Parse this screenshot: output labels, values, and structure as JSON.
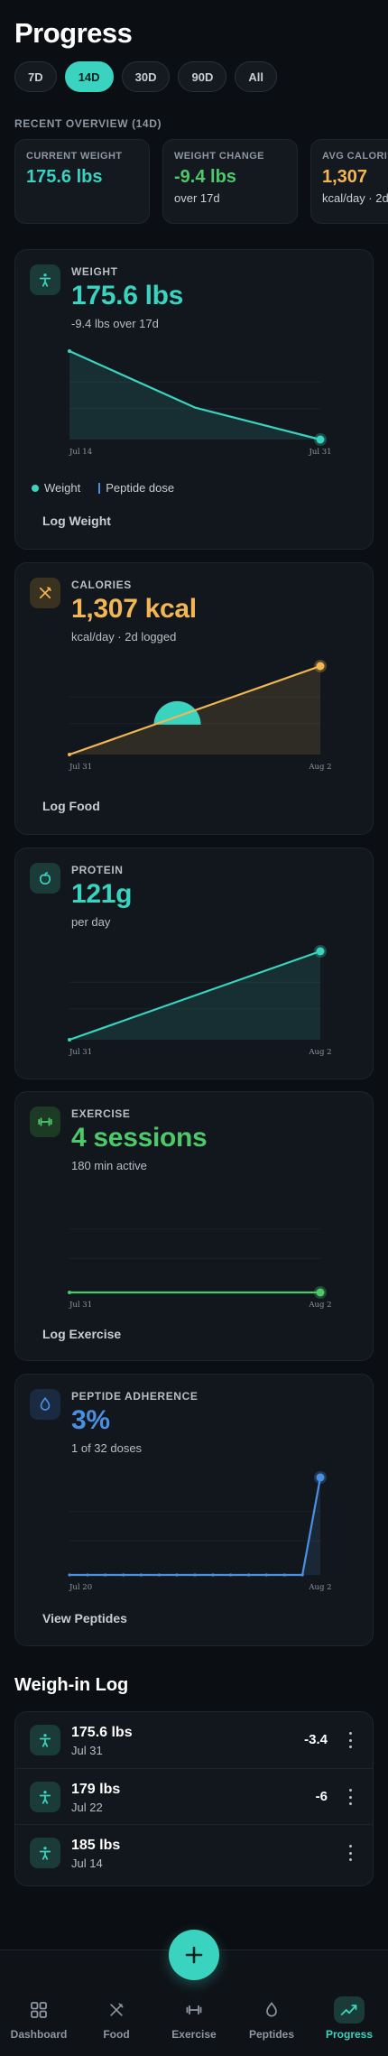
{
  "page": {
    "title": "Progress"
  },
  "ranges": [
    {
      "label": "7D",
      "active": false
    },
    {
      "label": "14D",
      "active": true
    },
    {
      "label": "30D",
      "active": false
    },
    {
      "label": "90D",
      "active": false
    },
    {
      "label": "All",
      "active": false
    }
  ],
  "overview": {
    "label": "RECENT OVERVIEW (14D)",
    "cards": [
      {
        "label": "CURRENT WEIGHT",
        "value": "175.6 lbs",
        "sub": "",
        "color": "#3ad3c0"
      },
      {
        "label": "WEIGHT CHANGE",
        "value": "-9.4 lbs",
        "sub": "over 17d",
        "color": "#4cc96a"
      },
      {
        "label": "AVG CALORIES",
        "value": "1,307",
        "sub": "kcal/day · 2d",
        "color": "#f3b654"
      }
    ]
  },
  "weight": {
    "label": "WEIGHT",
    "value": "175.6 lbs",
    "sub": "-9.4 lbs over 17d",
    "color": "#3ad3c0",
    "legend_weight": "Weight",
    "legend_peptide": "Peptide dose",
    "link": "Log Weight"
  },
  "calories": {
    "label": "CALORIES",
    "value": "1,307 kcal",
    "sub": "kcal/day · 2d logged",
    "color": "#f3b654",
    "link": "Log Food"
  },
  "protein": {
    "label": "PROTEIN",
    "value": "121g",
    "sub": "per day",
    "color": "#3ad3c0"
  },
  "exercise": {
    "label": "EXERCISE",
    "value": "4 sessions",
    "sub": "180 min active",
    "color": "#4cc96a",
    "link": "Log Exercise"
  },
  "peptide": {
    "label": "PEPTIDE ADHERENCE",
    "value": "3%",
    "sub": "1 of 32 doses",
    "color": "#4a90e2",
    "link": "View Peptides"
  },
  "chart_data": [
    {
      "type": "area",
      "series": [
        {
          "values": [
            185,
            179,
            175.6
          ]
        }
      ],
      "x": [
        "Jul 14",
        "Jul 22",
        "Jul 31"
      ],
      "tick_labels": [
        "Jul 14",
        "Jul 31"
      ]
    },
    {
      "type": "area",
      "x": [
        "Jul 31",
        "Aug 2"
      ],
      "tick_labels": [
        "Jul 31",
        "Aug 2"
      ],
      "series": [
        {
          "values": [
            400,
            1650
          ]
        }
      ]
    },
    {
      "type": "area",
      "x": [
        "Jul 31",
        "Aug 2"
      ],
      "tick_labels": [
        "Jul 31",
        "Aug 2"
      ],
      "series": [
        {
          "values": [
            0,
            121
          ]
        }
      ]
    },
    {
      "type": "line",
      "x": [
        "Jul 31",
        "Aug 2"
      ],
      "tick_labels": [
        "Jul 31",
        "Aug 2"
      ],
      "series": [
        {
          "values": [
            0,
            0
          ]
        }
      ]
    },
    {
      "type": "area",
      "x": [
        "Jul 20",
        "Aug 2"
      ],
      "tick_labels": [
        "Jul 20",
        "Aug 2"
      ],
      "series": [
        {
          "values": [
            0,
            0,
            0,
            0,
            0,
            0,
            0,
            0,
            0,
            0,
            0,
            0,
            0,
            0,
            1
          ]
        }
      ]
    }
  ],
  "log": {
    "title": "Weigh-in Log",
    "entries": [
      {
        "weight": "175.6 lbs",
        "date": "Jul 31",
        "change": "-3.4"
      },
      {
        "weight": "179 lbs",
        "date": "Jul 22",
        "change": "-6"
      },
      {
        "weight": "185 lbs",
        "date": "Jul 14",
        "change": ""
      }
    ]
  },
  "tabs": [
    {
      "label": "Dashboard",
      "icon": "grid-icon",
      "active": false
    },
    {
      "label": "Food",
      "icon": "utensils-icon",
      "active": false
    },
    {
      "label": "Exercise",
      "icon": "dumbbell-icon",
      "active": false
    },
    {
      "label": "Peptides",
      "icon": "droplet-icon",
      "active": false
    },
    {
      "label": "Progress",
      "icon": "trend-icon",
      "active": true
    }
  ],
  "colors": {
    "accent": "#3ad3c0",
    "orange": "#f3b654",
    "green": "#4cc96a",
    "blue": "#4a90e2"
  }
}
